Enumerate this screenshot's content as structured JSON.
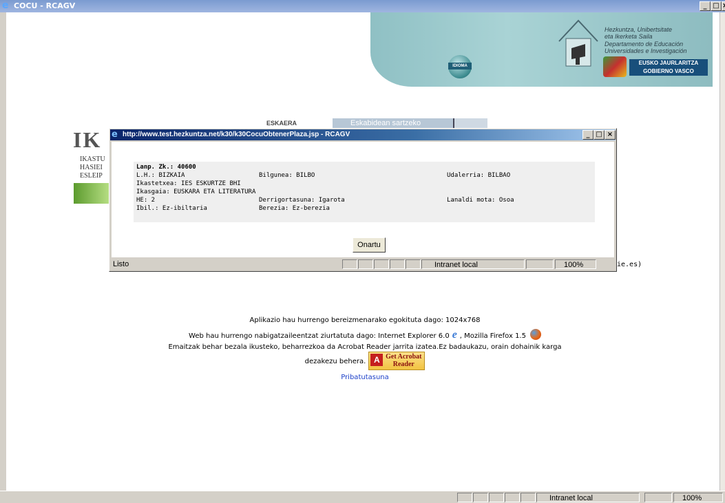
{
  "window": {
    "title": "COCU - RCAGV",
    "minimize": "_",
    "maximize": "□",
    "close": "×"
  },
  "banner": {
    "dept_eu_1": "Hezkuntza, Unibertsitate",
    "dept_eu_2": "eta Ikerketa Saila",
    "dept_es_1": "Departamento de Educación",
    "dept_es_2": "Universidades e Investigación",
    "idioma": "IDIOMA",
    "gov_1": "EUSKO JAURLARITZA",
    "gov_2": "GOBIERNO VASCO"
  },
  "background": {
    "logo": "IK",
    "side_lines": [
      "IKASTU",
      "HASIEI",
      "ESLEIP"
    ],
    "tab_label": "Eskabidean sartzeko",
    "section_label": "ESKAERA",
    "email_fragment": "ie.es)"
  },
  "popup": {
    "title": "http://www.test.hezkuntza.net/k30/k30CocuObtenerPlaza.jsp - RCAGV",
    "lanp": "Lanp. Zk.: 40600",
    "lh": "L.H.: BIZKAIA",
    "bilgunea": "Bilgunea: BILBO",
    "udalerria": "Udalerria: BILBAO",
    "ikastetxea": "Ikastetxea: IES ESKURTZE BHI",
    "ikasgaia": "Ikasgaia: EUSKARA ETA LITERATURA",
    "he": "HE: 2",
    "derrigortasuna": "Derrigortasuna: Igarota",
    "lanaldi": "Lanaldi mota: Osoa",
    "ibil": "Ibil.: Ez-ibiltaria",
    "berezia": "Berezia: Ez-berezia",
    "accept_button": "Onartu",
    "status": "Listo",
    "zone": "Intranet local",
    "zoom": "100%"
  },
  "footer": {
    "resolution": "Aplikazio hau hurrengo bereizmenarako egokituta dago:  1024x768",
    "browsers_prefix": "Web hau hurrengo nabigatzaileentzat ziurtatuta dago:   Internet Explorer 6.0",
    "browsers_suffix": ", Mozilla Firefox 1.5",
    "acrobat_line1": "Emaitzak behar bezala ikusteko, beharrezkoa da Acrobat Reader jarrita izatea.Ez badaukazu, orain dohainik karga",
    "acrobat_line2": "dezakezu behera.",
    "acrobat_badge_1": "Get Acrobat",
    "acrobat_badge_2": "Reader",
    "acrobat_brand": "Adobe",
    "privacy": "Pribatutasuna"
  },
  "statusbar": {
    "zone": "Intranet local",
    "zoom": "100%"
  }
}
